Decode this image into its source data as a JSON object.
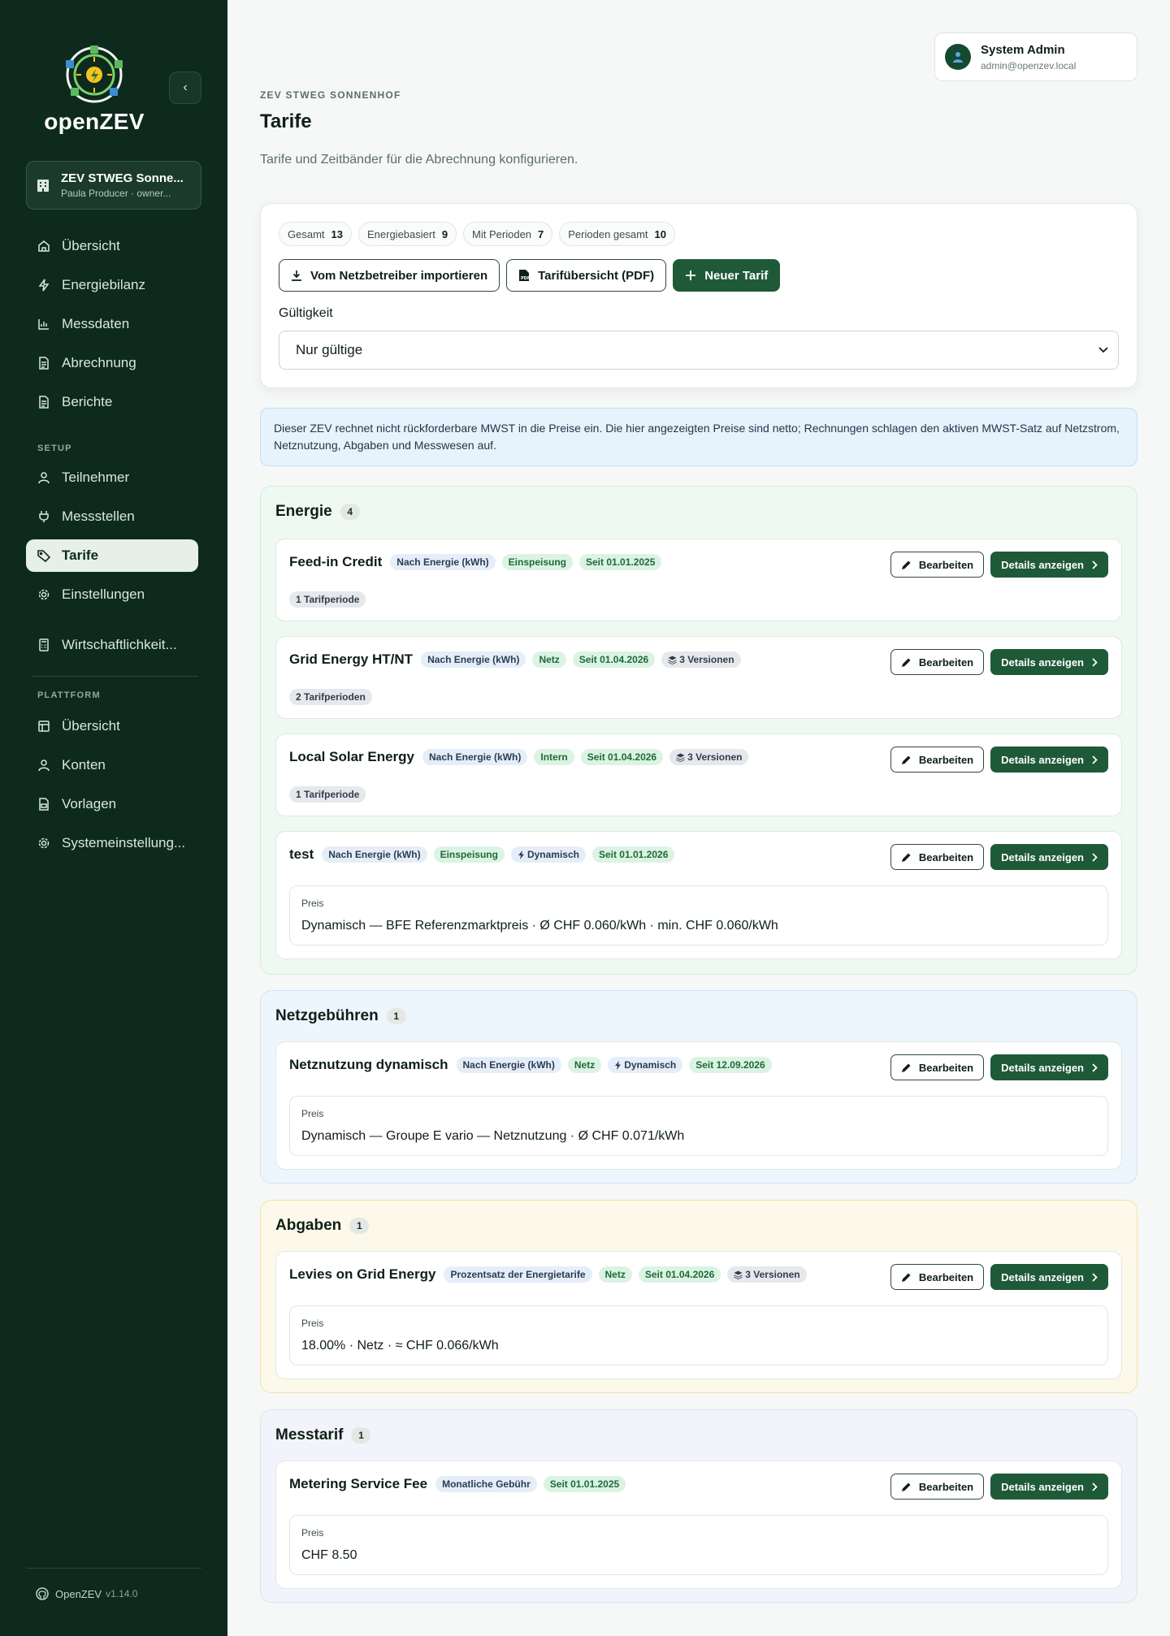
{
  "sidebar": {
    "logo_text": "openZEV",
    "zev_name": "ZEV STWEG Sonne...",
    "zev_user": "Paula Producer · owner...",
    "nav_main": [
      {
        "label": "Übersicht",
        "icon": "home-icon"
      },
      {
        "label": "Energiebilanz",
        "icon": "bolt-icon"
      },
      {
        "label": "Messdaten",
        "icon": "bar-chart-icon"
      },
      {
        "label": "Abrechnung",
        "icon": "document-icon"
      },
      {
        "label": "Berichte",
        "icon": "document-icon"
      }
    ],
    "setup_label": "SETUP",
    "nav_setup": [
      {
        "label": "Teilnehmer",
        "icon": "user-icon"
      },
      {
        "label": "Messstellen",
        "icon": "plug-icon"
      },
      {
        "label": "Tarife",
        "icon": "tag-icon",
        "active": true
      },
      {
        "label": "Einstellungen",
        "icon": "gear-icon"
      }
    ],
    "nav_extra": [
      {
        "label": "Wirtschaftlichkeit...",
        "icon": "calculator-icon"
      }
    ],
    "platform_label": "PLATTFORM",
    "nav_platform": [
      {
        "label": "Übersicht",
        "icon": "dashboard-icon"
      },
      {
        "label": "Konten",
        "icon": "user-icon"
      },
      {
        "label": "Vorlagen",
        "icon": "template-icon"
      },
      {
        "label": "Systemeinstellung...",
        "icon": "gear-icon"
      }
    ],
    "footer_name": "OpenZEV",
    "footer_version": "v1.14.0"
  },
  "user": {
    "name": "System Admin",
    "email": "admin@openzev.local"
  },
  "page": {
    "eyebrow": "ZEV STWEG SONNENHOF",
    "title": "Tarife",
    "subtitle": "Tarife und Zeitbänder für die Abrechnung konfigurieren."
  },
  "stats": [
    {
      "label": "Gesamt",
      "value": "13"
    },
    {
      "label": "Energiebasiert",
      "value": "9"
    },
    {
      "label": "Mit Perioden",
      "value": "7"
    },
    {
      "label": "Perioden gesamt",
      "value": "10"
    }
  ],
  "buttons": {
    "import": "Vom Netzbetreiber importieren",
    "pdf": "Tarifübersicht (PDF)",
    "new": "Neuer Tarif"
  },
  "filter": {
    "label": "Gültigkeit",
    "value": "Nur gültige"
  },
  "info": "Dieser ZEV rechnet nicht rückforderbare MWST in die Preise ein. Die hier angezeigten Preise sind netto; Rechnungen schlagen den aktiven MWST-Satz auf Netzstrom, Netznutzung, Abgaben und Messwesen auf.",
  "actions": {
    "edit": "Bearbeiten",
    "details": "Details anzeigen"
  },
  "price_label": "Preis",
  "groups": {
    "energie": {
      "title": "Energie",
      "count": "4",
      "tariffs": [
        {
          "name": "Feed-in Credit",
          "chips": [
            "Nach Energie (kWh)",
            "Einspeisung",
            "Seit 01.01.2025"
          ],
          "period": "1 Tarifperiode"
        },
        {
          "name": "Grid Energy HT/NT",
          "chips": [
            "Nach Energie (kWh)",
            "Netz",
            "Seit 01.04.2026",
            "3 Versionen"
          ],
          "period": "2 Tarifperioden"
        },
        {
          "name": "Local Solar Energy",
          "chips": [
            "Nach Energie (kWh)",
            "Intern",
            "Seit 01.04.2026",
            "3 Versionen"
          ],
          "period": "1 Tarifperiode"
        },
        {
          "name": "test",
          "chips": [
            "Nach Energie (kWh)",
            "Einspeisung",
            "Dynamisch",
            "Seit 01.01.2026"
          ],
          "price": "Dynamisch — BFE Referenzmarktpreis · Ø CHF 0.060/kWh · min. CHF 0.060/kWh"
        }
      ]
    },
    "netz": {
      "title": "Netzgebühren",
      "count": "1",
      "tariffs": [
        {
          "name": "Netznutzung dynamisch",
          "chips": [
            "Nach Energie (kWh)",
            "Netz",
            "Dynamisch",
            "Seit 12.09.2026"
          ],
          "price": "Dynamisch — Groupe E vario — Netznutzung · Ø CHF 0.071/kWh"
        }
      ]
    },
    "abgaben": {
      "title": "Abgaben",
      "count": "1",
      "tariffs": [
        {
          "name": "Levies on Grid Energy",
          "chips": [
            "Prozentsatz der Energietarife",
            "Netz",
            "Seit 01.04.2026",
            "3 Versionen"
          ],
          "price": "18.00% · Netz · ≈ CHF 0.066/kWh"
        }
      ]
    },
    "mess": {
      "title": "Messtarif",
      "count": "1",
      "tariffs": [
        {
          "name": "Metering Service Fee",
          "chips": [
            "Monatliche Gebühr",
            "Seit 01.01.2025"
          ],
          "price": "CHF 8.50"
        }
      ]
    }
  },
  "colors": {
    "sidebar": "#0d2a1d",
    "primary": "#1f5a38",
    "info_bg": "#e6f2fc"
  }
}
